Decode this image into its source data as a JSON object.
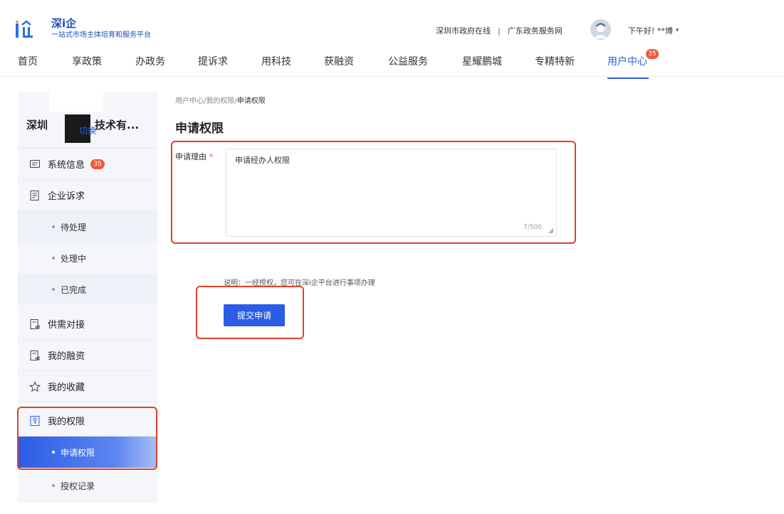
{
  "header": {
    "logo_title": "深i企",
    "logo_subtitle": "一站式市场主体培育和服务平台",
    "top_links": [
      "深圳市政府在线",
      "广东政务服务网"
    ],
    "top_link_separator": "|",
    "greeting": "下午好! **博",
    "nav": [
      {
        "label": "首页"
      },
      {
        "label": "享政策"
      },
      {
        "label": "办政务"
      },
      {
        "label": "提诉求"
      },
      {
        "label": "用科技"
      },
      {
        "label": "获融资"
      },
      {
        "label": "公益服务"
      },
      {
        "label": "星耀鹏城"
      },
      {
        "label": "专精特新"
      },
      {
        "label": "用户中心",
        "badge": "35",
        "active": true
      }
    ]
  },
  "sidebar": {
    "company_prefix": "深圳",
    "company_suffix": "技术有...",
    "switch_label": "切换",
    "items": [
      {
        "label": "系统信息",
        "badge": "35",
        "icon": "message-icon"
      },
      {
        "label": "企业诉求",
        "icon": "form-icon"
      },
      {
        "label": "待处理"
      },
      {
        "label": "处理中"
      },
      {
        "label": "已完成"
      },
      {
        "label": "供需对接",
        "icon": "document-icon"
      },
      {
        "label": "我的融资",
        "icon": "document-icon"
      },
      {
        "label": "我的收藏",
        "icon": "star-icon"
      },
      {
        "label": "我的权限",
        "icon": "key-icon"
      },
      {
        "label": "申请权限",
        "selected": true
      },
      {
        "label": "授权记录"
      }
    ]
  },
  "main": {
    "breadcrumb": [
      "用户中心",
      "我的权限",
      "申请权限"
    ],
    "breadcrumb_separator": "/",
    "title": "申请权限",
    "reason_label": "申请理由",
    "required_mark": "*",
    "reason_value": "申请经办人权限",
    "char_counter": "7/500",
    "note": "说明：一经授权，您可在深i企平台进行事项办理",
    "submit_label": "提交申请"
  },
  "colors": {
    "primary": "#2b5ce6",
    "badge": "#f05a3c",
    "annotation_red": "#e0402c",
    "sidebar_bg": "#f4f6fa"
  }
}
